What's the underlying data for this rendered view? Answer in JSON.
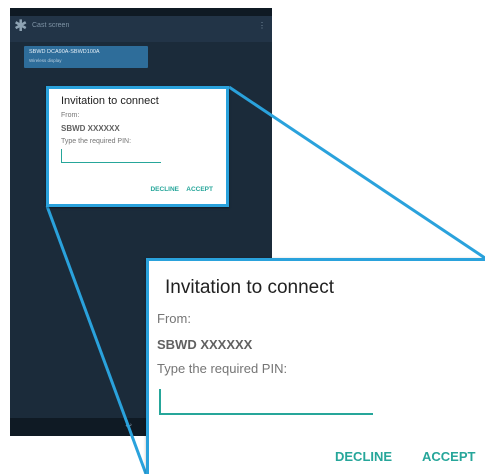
{
  "tablet": {
    "app_title": "Cast screen",
    "device": {
      "name": "SBWD DCA90A-SBWD100A",
      "subtitle": "Wireless display"
    },
    "nav_back_glyph": "↩"
  },
  "dialog": {
    "title": "Invitation to connect",
    "from_label": "From:",
    "device_name": "SBWD XXXXXX",
    "pin_prompt": "Type the required PIN:",
    "pin_value": "",
    "decline_label": "DECLINE",
    "accept_label": "ACCEPT"
  },
  "colors": {
    "accent": "#26a69a",
    "callout": "#2aa2dc",
    "screen_bg": "#1b2b3a",
    "selected_item": "#2e6d9a"
  },
  "icons": {
    "settings": "gear-icon",
    "overflow": "overflow-menu-icon",
    "back": "back-icon"
  }
}
